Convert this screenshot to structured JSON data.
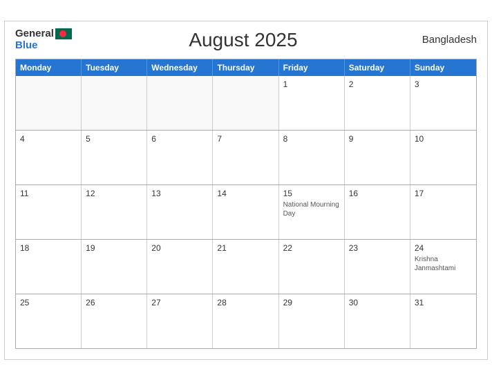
{
  "header": {
    "logo_general": "General",
    "logo_blue": "Blue",
    "title": "August 2025",
    "country": "Bangladesh"
  },
  "days_header": [
    "Monday",
    "Tuesday",
    "Wednesday",
    "Thursday",
    "Friday",
    "Saturday",
    "Sunday"
  ],
  "weeks": [
    [
      {
        "date": "",
        "event": ""
      },
      {
        "date": "",
        "event": ""
      },
      {
        "date": "",
        "event": ""
      },
      {
        "date": "",
        "event": ""
      },
      {
        "date": "1",
        "event": ""
      },
      {
        "date": "2",
        "event": ""
      },
      {
        "date": "3",
        "event": ""
      }
    ],
    [
      {
        "date": "4",
        "event": ""
      },
      {
        "date": "5",
        "event": ""
      },
      {
        "date": "6",
        "event": ""
      },
      {
        "date": "7",
        "event": ""
      },
      {
        "date": "8",
        "event": ""
      },
      {
        "date": "9",
        "event": ""
      },
      {
        "date": "10",
        "event": ""
      }
    ],
    [
      {
        "date": "11",
        "event": ""
      },
      {
        "date": "12",
        "event": ""
      },
      {
        "date": "13",
        "event": ""
      },
      {
        "date": "14",
        "event": ""
      },
      {
        "date": "15",
        "event": "National Mourning Day"
      },
      {
        "date": "16",
        "event": ""
      },
      {
        "date": "17",
        "event": ""
      }
    ],
    [
      {
        "date": "18",
        "event": ""
      },
      {
        "date": "19",
        "event": ""
      },
      {
        "date": "20",
        "event": ""
      },
      {
        "date": "21",
        "event": ""
      },
      {
        "date": "22",
        "event": ""
      },
      {
        "date": "23",
        "event": ""
      },
      {
        "date": "24",
        "event": "Krishna Janmashtami"
      }
    ],
    [
      {
        "date": "25",
        "event": ""
      },
      {
        "date": "26",
        "event": ""
      },
      {
        "date": "27",
        "event": ""
      },
      {
        "date": "28",
        "event": ""
      },
      {
        "date": "29",
        "event": ""
      },
      {
        "date": "30",
        "event": ""
      },
      {
        "date": "31",
        "event": ""
      }
    ]
  ]
}
